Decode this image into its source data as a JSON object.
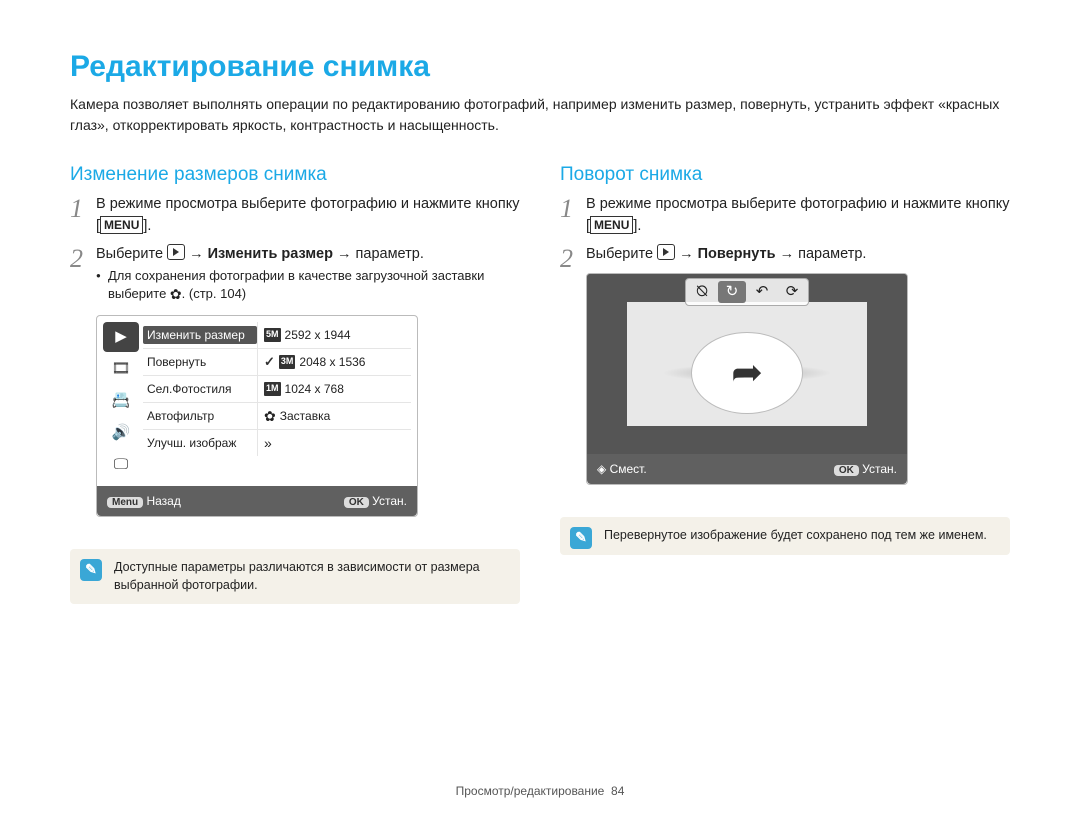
{
  "page": {
    "title": "Редактирование снимка",
    "intro": "Камера позволяет выполнять операции по редактированию фотографий, например изменить размер, повернуть, устранить эффект «красных глаз», откорректировать яркость, контрастность и насыщенность."
  },
  "left": {
    "title": "Изменение размеров снимка",
    "step1_a": "В режиме просмотра выберите фотографию и нажмите кнопку [",
    "step1_key": "MENU",
    "step1_b": "].",
    "step2_a": "Выберите ",
    "step2_b": " → ",
    "step2_bold": "Изменить размер",
    "step2_c": " → параметр.",
    "sub_a": "Для сохранения фотографии в качестве загрузочной заставки выберите ",
    "sub_b": ". (стр. 104)",
    "menu": {
      "items": [
        "Изменить размер",
        "Повернуть",
        "Сел.Фотостиля",
        "Автофильтр",
        "Улучш. изображ"
      ],
      "sizes": [
        {
          "tag": "5M",
          "label": "2592 x 1944",
          "checked": false
        },
        {
          "tag": "3M",
          "label": "2048 x 1536",
          "checked": true
        },
        {
          "tag": "1M",
          "label": "1024 x 768",
          "checked": false
        },
        {
          "tag": "",
          "label": "Заставка",
          "checked": false,
          "icon": true
        }
      ],
      "footer_left_key": "Menu",
      "footer_left": "Назад",
      "footer_right_key": "OK",
      "footer_right": "Устан."
    },
    "note": "Доступные параметры различаются в зависимости от размера выбранной фотографии."
  },
  "right": {
    "title": "Поворот снимка",
    "step1_a": "В режиме просмотра выберите фотографию и нажмите кнопку [",
    "step1_key": "MENU",
    "step1_b": "].",
    "step2_a": "Выберите ",
    "step2_b": " → ",
    "step2_bold": "Повернуть",
    "step2_c": " → параметр.",
    "footer_left": "Смест.",
    "footer_right_key": "OK",
    "footer_right": "Устан.",
    "note": "Перевернутое изображение будет сохранено под тем же именем."
  },
  "footer": {
    "section": "Просмотр/редактирование",
    "page_num": "84"
  }
}
